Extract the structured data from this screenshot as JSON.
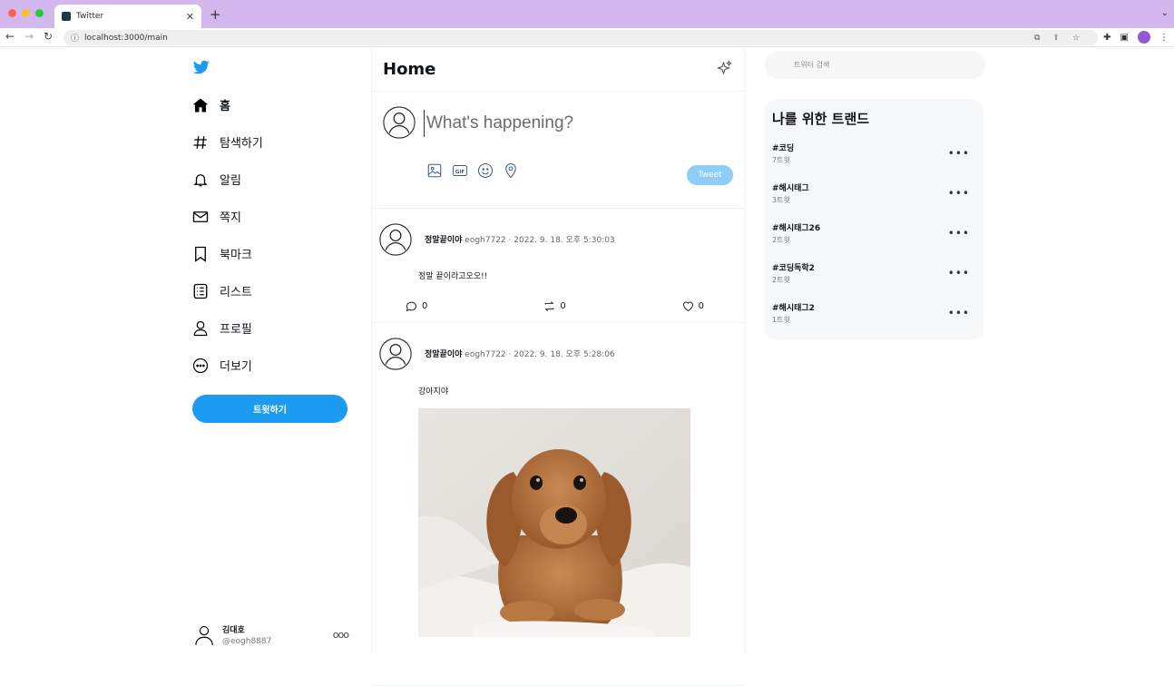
{
  "browser": {
    "tab_title": "Twitter",
    "url": "localhost:3000/main"
  },
  "sidebar": {
    "items": [
      {
        "label": "홈",
        "icon": "home-icon"
      },
      {
        "label": "탐색하기",
        "icon": "hashtag-icon"
      },
      {
        "label": "알림",
        "icon": "bell-icon"
      },
      {
        "label": "쪽지",
        "icon": "envelope-icon"
      },
      {
        "label": "북마크",
        "icon": "bookmark-icon"
      },
      {
        "label": "리스트",
        "icon": "list-icon"
      },
      {
        "label": "프로필",
        "icon": "person-icon"
      },
      {
        "label": "더보기",
        "icon": "more-circle-icon"
      }
    ],
    "tweet_button": "트윗하기",
    "account": {
      "name": "김대호",
      "handle": "@eogh8887"
    }
  },
  "main": {
    "title": "Home",
    "compose": {
      "placeholder": "What's happening?",
      "submit": "Tweet"
    },
    "posts": [
      {
        "name": "정말끝이야",
        "handle": "eogh7722",
        "separator": "·",
        "date": "2022. 9. 18. 오후 5:30:03",
        "text": "정말 끝이라고오오!!",
        "replies": "0",
        "retweets": "0",
        "likes": "0"
      },
      {
        "name": "정말끝이야",
        "handle": "eogh7722",
        "separator": "·",
        "date": "2022. 9. 18. 오후 5:28:06",
        "text": "강아지야"
      }
    ]
  },
  "right": {
    "search_placeholder": "트위터 검색",
    "trends_title": "나를 위한 트랜드",
    "trends": [
      {
        "tag": "#코딩",
        "count": "7트윗"
      },
      {
        "tag": "#해시태그",
        "count": "3트윗"
      },
      {
        "tag": "#해시태그26",
        "count": "2트윗"
      },
      {
        "tag": "#코딩독학2",
        "count": "2트윗"
      },
      {
        "tag": "#해시태그2",
        "count": "1트윗"
      }
    ]
  },
  "colors": {
    "accent": "#1d9bf0",
    "accent_disabled": "#8ecdf8",
    "chrome_tabbar": "#d3b8ee"
  }
}
